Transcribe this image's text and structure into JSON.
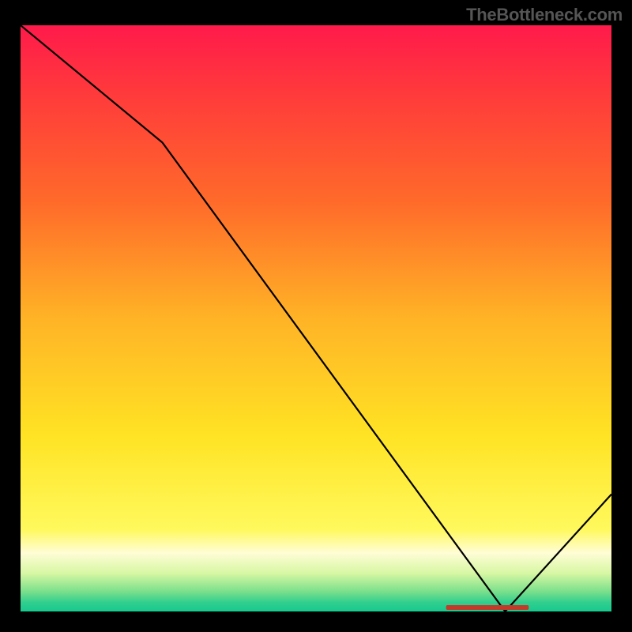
{
  "attribution": "TheBottleneck.com",
  "chart_data": {
    "type": "line",
    "title": "",
    "xlabel": "",
    "ylabel": "",
    "xlim": [
      0,
      100
    ],
    "ylim": [
      0,
      100
    ],
    "series": [
      {
        "name": "bottleneck-curve",
        "x": [
          0,
          24,
          82,
          100
        ],
        "values": [
          100,
          80,
          0,
          20
        ]
      }
    ],
    "marker": {
      "name": "optimal-range-marker",
      "label": "",
      "x_start": 72,
      "x_end": 86,
      "y": 0
    },
    "background": {
      "type": "vertical-gradient",
      "stops": [
        {
          "pos": 0.0,
          "color": "#ff1a4b"
        },
        {
          "pos": 0.12,
          "color": "#ff3b3b"
        },
        {
          "pos": 0.3,
          "color": "#ff6a2a"
        },
        {
          "pos": 0.5,
          "color": "#ffb326"
        },
        {
          "pos": 0.7,
          "color": "#ffe324"
        },
        {
          "pos": 0.86,
          "color": "#fff95d"
        },
        {
          "pos": 0.9,
          "color": "#fffdd6"
        },
        {
          "pos": 0.935,
          "color": "#d7f7a3"
        },
        {
          "pos": 0.965,
          "color": "#7ee08c"
        },
        {
          "pos": 0.985,
          "color": "#2fcf8e"
        },
        {
          "pos": 1.0,
          "color": "#18c98e"
        }
      ]
    }
  }
}
